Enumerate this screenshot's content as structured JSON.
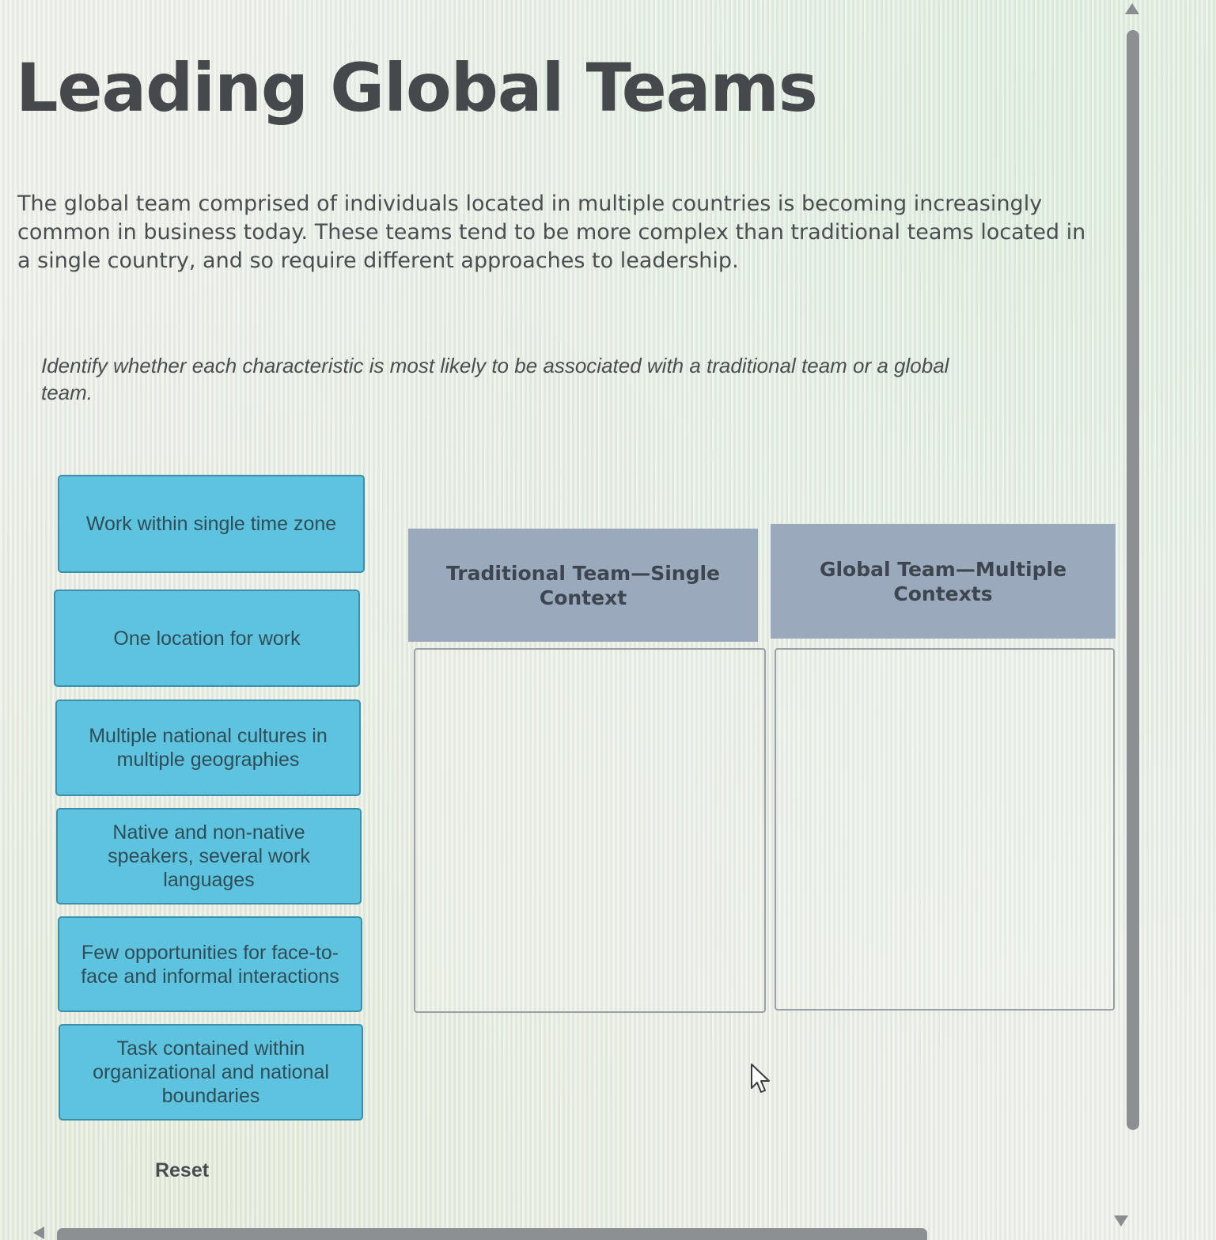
{
  "page": {
    "title": "Leading Global Teams",
    "intro": "The global team comprised of individuals located in multiple countries is becoming increasingly common in business today. These teams tend to be more complex than traditional teams located in a single country, and so require different approaches to leadership.",
    "instructions": "Identify whether each characteristic is most likely to be associated with a traditional team or a global team."
  },
  "cards": [
    {
      "label": "Work within single time zone"
    },
    {
      "label": "One location for work"
    },
    {
      "label": "Multiple national cultures in multiple geographies"
    },
    {
      "label": "Native and non-native speakers, several work languages"
    },
    {
      "label": "Few opportunities for face-to-face and informal interactions"
    },
    {
      "label": "Task contained within organizational and national boundaries"
    }
  ],
  "columns": [
    {
      "header": "Traditional Team—Single Context"
    },
    {
      "header": "Global Team—Multiple Contexts"
    }
  ],
  "reset_label": "Reset",
  "icons": {
    "cursor": "mouse-pointer-icon",
    "scroll_up": "chevron-up-icon",
    "scroll_down": "chevron-down-icon",
    "scroll_left": "chevron-left-icon"
  },
  "colors": {
    "card_fill": "#5ec3de",
    "card_border": "#3b8fab",
    "header_fill": "#9aa9bc",
    "text": "#45494c"
  }
}
